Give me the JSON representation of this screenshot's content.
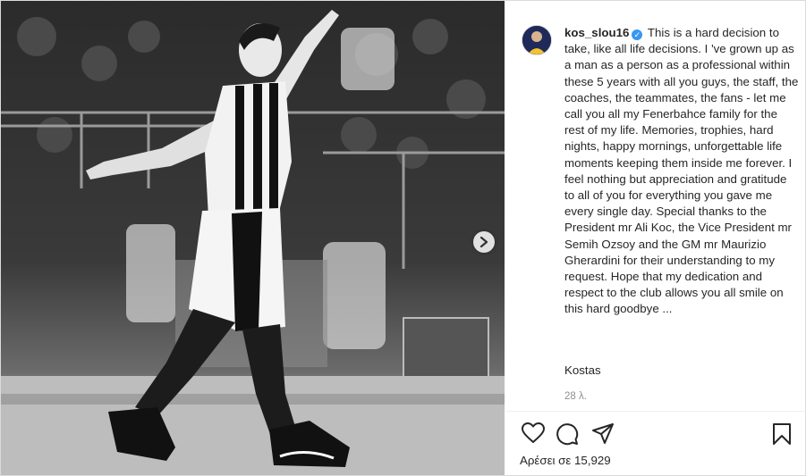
{
  "post": {
    "username": "kos_slou16",
    "caption": "This is a hard decision to take, like all life decisions. I 've grown up as a man as a person as a professional within these 5 years with all you guys, the staff, the coaches, the teammates, the fans - let me call you all my Fenerbahce family for the rest of my life. Memories, trophies, hard nights, happy mornings, unforgettable life moments keeping them inside me forever. I feel nothing but appreciation and gratitude to all of you for everything you gave me every single day. Special thanks to the President mr Ali Koc, the Vice President mr Semih Ozsoy and the GM mr Maurizio Gherardini for their understanding to my request. Hope that my dedication and respect to the club allows you all smile on this hard goodbye ...",
    "signoff": "Kostas",
    "time_ago": "28 λ.",
    "likes_label": "Αρέσει σε 15,929"
  },
  "icons": {
    "verified": "verified-badge-icon",
    "like": "heart-icon",
    "comment": "comment-icon",
    "share": "paper-plane-icon",
    "save": "bookmark-icon",
    "carousel_next": "chevron-right-icon"
  },
  "colors": {
    "verified": "#3897f0",
    "text": "#262626",
    "muted": "#8e8e8e"
  }
}
